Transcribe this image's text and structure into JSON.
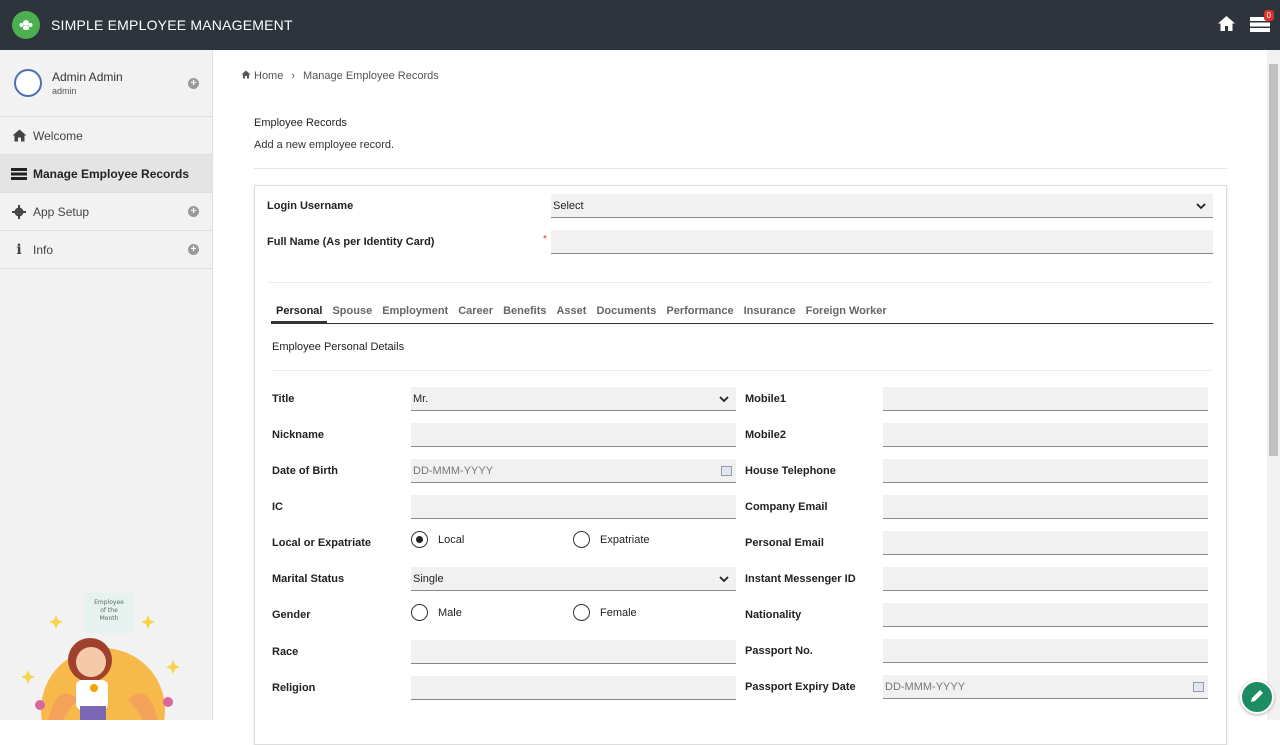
{
  "app": {
    "title": "SIMPLE EMPLOYEE MANAGEMENT",
    "notification_count": "0"
  },
  "user": {
    "name": "Admin Admin",
    "role": "admin"
  },
  "sidebar": {
    "items": [
      {
        "label": "Welcome"
      },
      {
        "label": "Manage Employee Records"
      },
      {
        "label": "App Setup"
      },
      {
        "label": "Info"
      }
    ]
  },
  "mascot": {
    "lettering": "Employee of the Month"
  },
  "breadcrumb": {
    "home": "Home",
    "current": "Manage Employee Records"
  },
  "page": {
    "title": "Employee Records",
    "subtitle": "Add a new employee record."
  },
  "form": {
    "login_username_label": "Login Username",
    "login_username_value": "Select",
    "full_name_label": "Full Name (As per Identity Card)",
    "required_mark": "*"
  },
  "tabs": [
    "Personal",
    "Spouse",
    "Employment",
    "Career",
    "Benefits",
    "Asset",
    "Documents",
    "Performance",
    "Insurance",
    "Foreign Worker"
  ],
  "personal": {
    "section_title": "Employee Personal Details",
    "title_label": "Title",
    "title_value": "Mr.",
    "nickname_label": "Nickname",
    "dob_label": "Date of Birth",
    "dob_placeholder": "DD-MMM-YYYY",
    "ic_label": "IC",
    "local_label": "Local or Expatriate",
    "local_opt": "Local",
    "expat_opt": "Expatriate",
    "marital_label": "Marital Status",
    "marital_value": "Single",
    "gender_label": "Gender",
    "male_opt": "Male",
    "female_opt": "Female",
    "race_label": "Race",
    "religion_label": "Religion",
    "mobile1_label": "Mobile1",
    "mobile2_label": "Mobile2",
    "house_tel_label": "House Telephone",
    "company_email_label": "Company Email",
    "personal_email_label": "Personal Email",
    "im_label": "Instant Messenger ID",
    "nationality_label": "Nationality",
    "passport_label": "Passport No.",
    "passport_expiry_label": "Passport Expiry Date",
    "passport_expiry_placeholder": "DD-MMM-YYYY"
  }
}
